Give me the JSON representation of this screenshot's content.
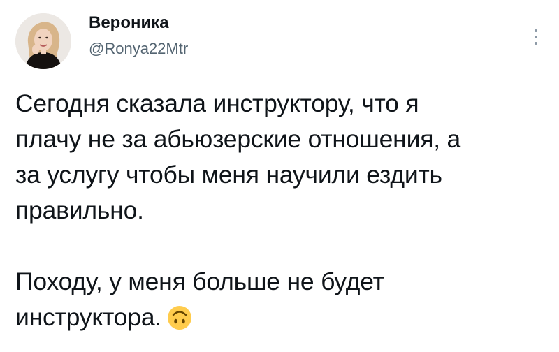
{
  "author": {
    "name": "Вероника",
    "handle": "@Ronya22Mtr"
  },
  "tweet": {
    "paragraph1": [
      "Сегодня сказала инструктору, что я",
      "плачу не за абьюзерские отношения, а",
      "за услугу чтобы меня научили ездить",
      "правильно."
    ],
    "paragraph2": [
      "Походу, у меня больше не будет",
      "инструктора."
    ],
    "emoji": "upside-down-face"
  },
  "icons": {
    "more": "more-vertical-icon",
    "avatar": "profile-photo"
  },
  "colors": {
    "text": "#0f1419",
    "secondary": "#536471",
    "emoji_fill": "#ffcc4d",
    "more_dots": "#8b98a5"
  }
}
